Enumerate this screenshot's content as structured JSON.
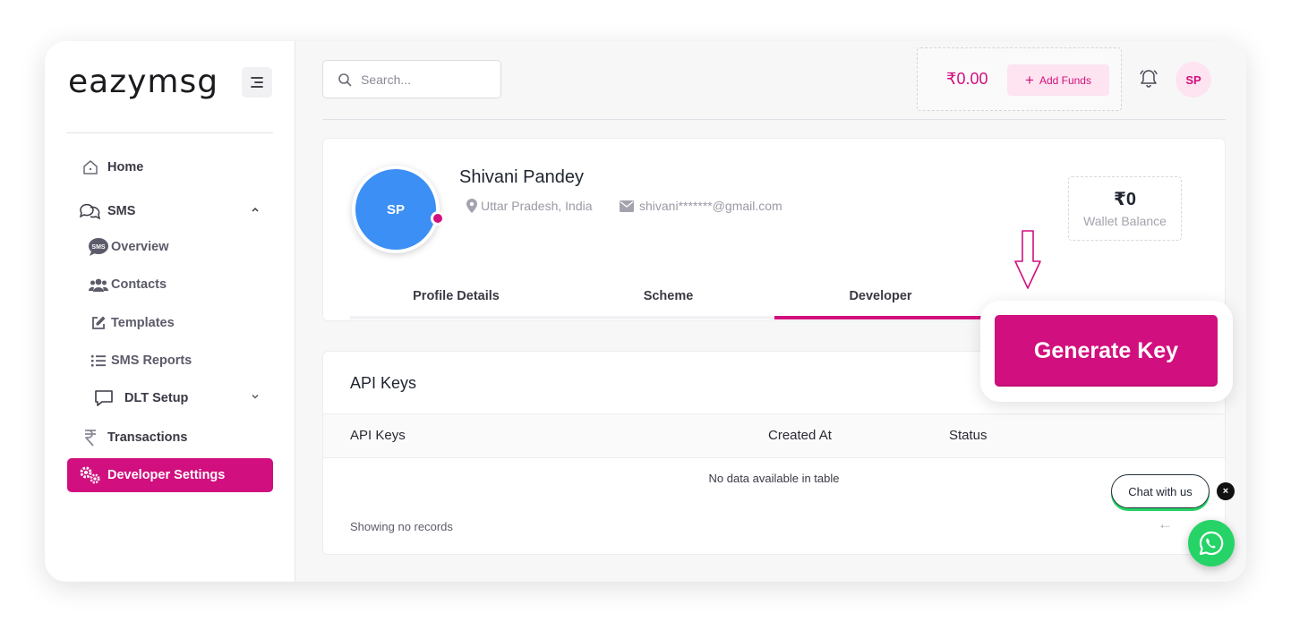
{
  "brand": {
    "logo": "eazymsg"
  },
  "sidebar": {
    "items": [
      {
        "label": "Home",
        "icon": "home-icon"
      },
      {
        "label": "SMS",
        "icon": "chat-bubbles-icon"
      },
      {
        "label": "Overview",
        "icon": "sms-bubble-icon"
      },
      {
        "label": "Contacts",
        "icon": "users-icon"
      },
      {
        "label": "Templates",
        "icon": "edit-icon"
      },
      {
        "label": "SMS Reports",
        "icon": "list-icon"
      },
      {
        "label": "DLT Setup",
        "icon": "message-square-icon"
      },
      {
        "label": "Transactions",
        "icon": "rupee-icon"
      },
      {
        "label": "Developer Settings",
        "icon": "gears-icon"
      }
    ],
    "sms_overview_badge": "SMS"
  },
  "header": {
    "search_placeholder": "Search...",
    "wallet_amount": "₹0.00",
    "add_funds_plus": "+",
    "add_funds_label": "Add Funds",
    "avatar_initials": "SP"
  },
  "profile": {
    "initials": "SP",
    "name": "Shivani Pandey",
    "location": "Uttar Pradesh, India",
    "email": "shivani*******@gmail.com",
    "wallet_balance": "₹0",
    "wallet_balance_label": "Wallet Balance",
    "tabs": [
      {
        "label": "Profile Details"
      },
      {
        "label": "Scheme"
      },
      {
        "label": "Developer"
      }
    ]
  },
  "api": {
    "title": "API Keys",
    "columns": [
      "API Keys",
      "Created At",
      "Status"
    ],
    "empty_message": "No data available in table",
    "footer": "Showing no records",
    "pager_prev": "←"
  },
  "callout": {
    "button_label": "Generate Key"
  },
  "chat": {
    "label": "Chat with us",
    "close": "×"
  },
  "colors": {
    "accent": "#d10f7e",
    "avatar_blue": "#3b8ff5",
    "whatsapp": "#25d366"
  }
}
